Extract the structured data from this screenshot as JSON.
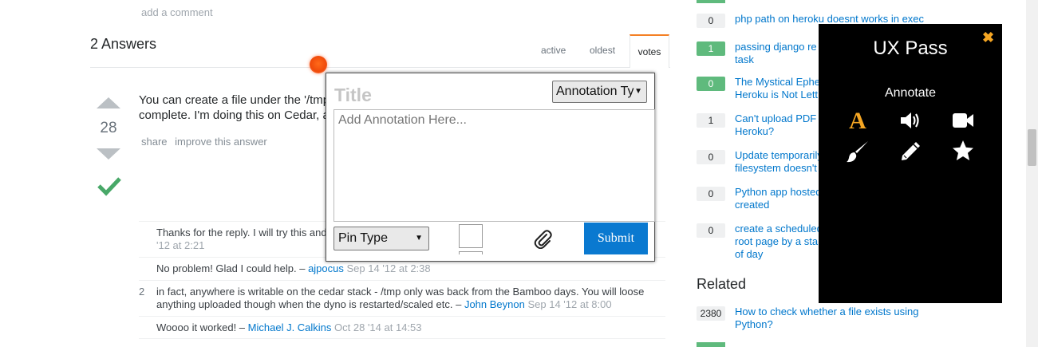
{
  "question": {
    "add_comment": "add a comment"
  },
  "answers": {
    "title": "2 Answers",
    "tabs": [
      "active",
      "oldest",
      "votes"
    ],
    "active_tab": "votes",
    "vote_count": "28",
    "text_line1": "You can create a file under the '/tmp",
    "text_line2": "complete. I'm doing this on Cedar, a",
    "actions": [
      "share",
      "improve this answer"
    ]
  },
  "comments": [
    {
      "score": "",
      "text": "Thanks for the reply. I will try this and",
      "user": "",
      "date": "'12 at 2:21"
    },
    {
      "score": "",
      "text": "No problem! Glad I could help. – ",
      "user": "ajpocus",
      "date": "Sep 14 '12 at 2:38"
    },
    {
      "score": "2",
      "text": "in fact, anywhere is writable on the cedar stack - /tmp only was back from the Bamboo days. You will loose anything uploaded though when the dyno is restarted/scaled etc. – ",
      "user": "John Beynon",
      "date": "Sep 14 '12 at 8:00"
    },
    {
      "score": "",
      "text": "Woooo it worked! – ",
      "user": "Michael J. Calkins",
      "date": "Oct 28 '14 at 14:53"
    }
  ],
  "sidebar": {
    "linked": [
      {
        "count": "0",
        "green": false,
        "title": "php path on heroku doesnt works in exec"
      },
      {
        "count": "1",
        "green": true,
        "title": "passing django re\ntask"
      },
      {
        "count": "0",
        "green": true,
        "title": "The Mystical Ephe\nHeroku is Not Lett"
      },
      {
        "count": "1",
        "green": false,
        "title": "Can't upload PDF\nHeroku?"
      },
      {
        "count": "0",
        "green": false,
        "title": "Update temporarily\nfilesystem doesn't"
      },
      {
        "count": "0",
        "green": false,
        "title": "Python app hosted\ncreated"
      },
      {
        "count": "0",
        "green": false,
        "title": "create a scheduled\nroot page by a sta\nof day"
      }
    ],
    "related_title": "Related",
    "related": [
      {
        "count": "2380",
        "title": "How to check whether a file exists using\nPython?"
      }
    ]
  },
  "annotation_popup": {
    "title_placeholder": "Title",
    "type_select": "Annotation Ty",
    "body_placeholder": "Add Annotation Here...",
    "pin_select": "Pin Type",
    "submit_label": "Submit",
    "pin_color": "#f04a0a",
    "submit_color": "#0a79d0"
  },
  "ux_panel": {
    "title": "UX Pass",
    "subtitle": "Annotate",
    "close_icon": "close-icon",
    "accent": "#f5a623",
    "tools": [
      "text-tool-icon",
      "audio-icon",
      "video-icon",
      "brush-icon",
      "pencil-icon",
      "star-icon"
    ]
  }
}
